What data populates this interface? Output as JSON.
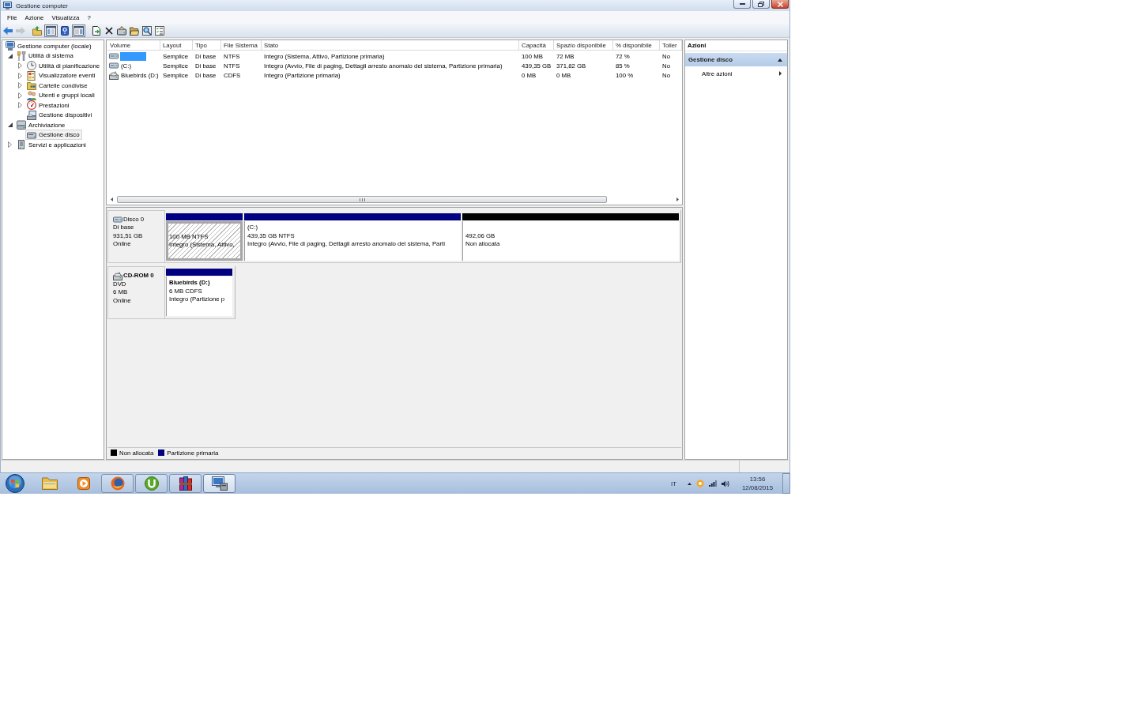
{
  "window": {
    "title": "Gestione computer"
  },
  "menu": [
    "File",
    "Azione",
    "Visualizza",
    "?"
  ],
  "toolbar": [
    {
      "kind": "back",
      "disabled": false,
      "pressed": false
    },
    {
      "kind": "forward",
      "disabled": true,
      "pressed": false
    },
    {
      "kind": "up",
      "disabled": false,
      "pressed": false
    },
    {
      "kind": "console_tree",
      "disabled": false,
      "pressed": true
    },
    {
      "kind": "help",
      "disabled": false,
      "pressed": false
    },
    {
      "kind": "action_pane",
      "disabled": false,
      "pressed": true
    },
    {
      "kind": "export",
      "disabled": false,
      "pressed": false
    },
    {
      "kind": "delete",
      "disabled": false,
      "pressed": false
    },
    {
      "kind": "drive",
      "disabled": false,
      "pressed": false
    },
    {
      "kind": "folder",
      "disabled": false,
      "pressed": false
    },
    {
      "kind": "find",
      "disabled": false,
      "pressed": false
    },
    {
      "kind": "checklist",
      "disabled": false,
      "pressed": false
    }
  ],
  "tree": {
    "items": [
      {
        "label": "Gestione computer (locale)",
        "kind": "computer",
        "selected": false,
        "children": [
          {
            "label": "Utilità di sistema",
            "kind": "tools",
            "expanded": true,
            "selected": false,
            "children": [
              {
                "label": "Utilità di pianificazione",
                "kind": "scheduler",
                "expanded": false,
                "selected": false
              },
              {
                "label": "Visualizzatore eventi",
                "kind": "events",
                "expanded": false,
                "selected": false
              },
              {
                "label": "Cartelle condivise",
                "kind": "shares",
                "expanded": false,
                "selected": false
              },
              {
                "label": "Utenti e gruppi locali",
                "kind": "users",
                "expanded": false,
                "selected": false
              },
              {
                "label": "Prestazioni",
                "kind": "performance",
                "expanded": false,
                "selected": false
              },
              {
                "label": "Gestione dispositivi",
                "kind": "devices",
                "selected": false
              }
            ]
          },
          {
            "label": "Archiviazione",
            "kind": "storage",
            "expanded": true,
            "selected": false,
            "children": [
              {
                "label": "Gestione disco",
                "kind": "disk",
                "selected": true
              }
            ]
          },
          {
            "label": "Servizi e applicazioni",
            "kind": "services",
            "expanded": false,
            "selected": false
          }
        ]
      }
    ]
  },
  "table": {
    "columns": [
      "Volume",
      "Layout",
      "Tipo",
      "File Sistema",
      "Stato",
      "Capacità",
      "Spazio disponibile",
      "% disponibile",
      "Toller"
    ],
    "rows": [
      {
        "kind": "disk",
        "selected": true,
        "layout": "Semplice",
        "type": "Di base",
        "file_system": "NTFS",
        "status": "Integro (Sistema, Attivo, Partizione primaria)",
        "capacity": "100 MB",
        "free_space": "72 MB",
        "percent_free": "72 %",
        "column_9": "No"
      },
      {
        "kind": "disk",
        "selected": false,
        "volume": "(C:)",
        "layout": "Semplice",
        "type": "Di base",
        "file_system": "NTFS",
        "status": "Integro (Avvio, File di paging, Dettagli arresto anomalo del sistema, Partizione primaria)",
        "capacity": "439,35 GB",
        "free_space": "371,82 GB",
        "percent_free": "85 %",
        "column_9": "No"
      },
      {
        "kind": "cdrom",
        "selected": false,
        "volume": "Bluebirds (D:)",
        "layout": "Semplice",
        "type": "Di base",
        "file_system": "CDFS",
        "status": "Integro (Partizione primaria)",
        "capacity": "0 MB",
        "free_space": "0 MB",
        "percent_free": "100 %",
        "column_9": "No"
      }
    ]
  },
  "disk_map": {
    "disks": [
      {
        "kind": "disk",
        "name": "Disco 0",
        "type": "Di base",
        "size": "931,51 GB",
        "status": "Online",
        "partitions": [
          {
            "color": "#000080",
            "selected": true,
            "size": "100 MB NTFS",
            "status": "Integro (Sistema, Attivo,"
          },
          {
            "color": "#000080",
            "selected": false,
            "name": "(C:)",
            "size": "439,35 GB NTFS",
            "status": "Integro (Avvio, File di paging, Dettagli arresto anomalo del sistema, Parti"
          },
          {
            "color": "#000000",
            "selected": false,
            "size": "492,06 GB",
            "status": "Non allocata"
          }
        ]
      },
      {
        "kind": "cdrom",
        "name": "CD-ROM 0",
        "type": "DVD",
        "size": "6 MB",
        "status": "Online",
        "partitions": [
          {
            "color": "#000080",
            "selected": false,
            "name": "Bluebirds (D:)",
            "size": "6 MB CDFS",
            "status": "Integro (Partizione p"
          }
        ]
      }
    ],
    "legend": [
      {
        "label": "Non allocata",
        "color": "#000000"
      },
      {
        "label": "Partizione primaria",
        "color": "#000080"
      }
    ]
  },
  "actions": {
    "title": "Azioni",
    "sections": [
      {
        "title": "Gestione disco",
        "expanded": true,
        "items": [
          {
            "label": "Altre azioni",
            "submenu": true
          }
        ]
      }
    ]
  },
  "taskbar": {
    "apps": [
      {
        "kind": "explorer",
        "running": false,
        "selected": false
      },
      {
        "kind": "media",
        "running": false,
        "selected": false
      },
      {
        "kind": "browser",
        "running": true,
        "selected": false
      },
      {
        "kind": "torrent",
        "running": true,
        "selected": false
      },
      {
        "kind": "archiver",
        "running": true,
        "selected": false
      },
      {
        "kind": "mmc",
        "running": true,
        "selected": true
      }
    ],
    "language": "IT",
    "time": "13:56",
    "date": "12/08/2015"
  }
}
